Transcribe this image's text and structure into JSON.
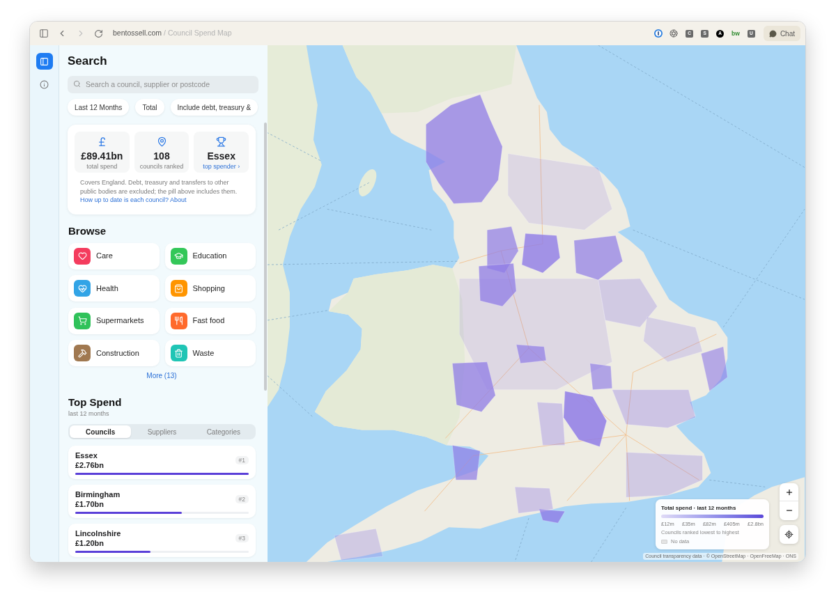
{
  "browser": {
    "nav": {
      "back_disabled": false,
      "forward_disabled": true
    },
    "domain": "bentossell.com",
    "path": "/ Council Spend Map",
    "extension_badges": [
      {
        "label": "C",
        "kind": "square"
      },
      {
        "label": "S",
        "kind": "square"
      },
      {
        "label": "A",
        "kind": "circle"
      },
      {
        "label": "bw",
        "kind": "plain"
      },
      {
        "label": "U",
        "kind": "square"
      }
    ],
    "chat_button": "Chat"
  },
  "rail": {
    "items": [
      {
        "selected": true
      },
      {
        "selected": false
      }
    ]
  },
  "search": {
    "title": "Search",
    "placeholder": "Search a council, supplier or postcode"
  },
  "filter_pills": [
    "Last 12 Months",
    "Total",
    "Include debt, treasury &"
  ],
  "summary": {
    "stats": [
      {
        "value": "£89.41bn",
        "caption": "total spend",
        "kind": "plain"
      },
      {
        "value": "108",
        "caption": "councils ranked",
        "kind": "plain"
      },
      {
        "value": "Essex",
        "caption": "top spender ›",
        "kind": "link"
      }
    ],
    "note": "Covers England. Debt, treasury and transfers to other public bodies are excluded; the pill above includes them.",
    "links": [
      "How up to date is each council?",
      "About"
    ]
  },
  "browse": {
    "title": "Browse",
    "categories": [
      {
        "label": "Care",
        "color": "#f43c5e"
      },
      {
        "label": "Education",
        "color": "#34c759"
      },
      {
        "label": "Health",
        "color": "#32a4e6"
      },
      {
        "label": "Shopping",
        "color": "#ff9500"
      },
      {
        "label": "Supermarkets",
        "color": "#30c25a"
      },
      {
        "label": "Fast food",
        "color": "#ff6a2c"
      },
      {
        "label": "Construction",
        "color": "#a07850"
      },
      {
        "label": "Waste",
        "color": "#20c5b5"
      }
    ],
    "more_link": "More (13)"
  },
  "top_spend": {
    "title": "Top Spend",
    "subtitle": "last 12 months",
    "tabs": [
      {
        "label": "Councils",
        "selected": true
      },
      {
        "label": "Suppliers",
        "selected": false
      },
      {
        "label": "Categories",
        "selected": false
      }
    ],
    "rows": [
      {
        "name": "Essex",
        "amount": "£2.76bn",
        "rank": "#1",
        "level": 1
      },
      {
        "name": "Birmingham",
        "amount": "£1.70bn",
        "rank": "#2",
        "level": 0.616
      },
      {
        "name": "Lincolnshire",
        "amount": "£1.20bn",
        "rank": "#3",
        "level": 0.435
      }
    ]
  },
  "map": {
    "legend": {
      "title": "Total spend · last 12 months",
      "scale_labels": [
        "£12m",
        "£35m",
        "£82m",
        "£405m",
        "£2.8bn"
      ],
      "caption": "Councils ranked lowest to highest",
      "no_data_label": "No data"
    },
    "attribution": "Council transparency data · © OpenStreetMap · OpenFreeMap · ONS"
  }
}
